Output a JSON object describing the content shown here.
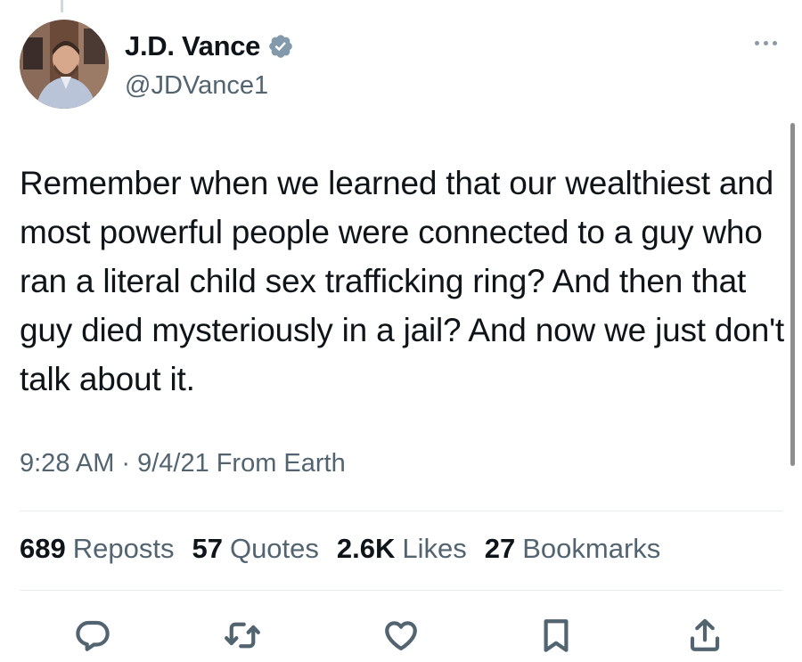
{
  "tweet": {
    "author": {
      "name": "J.D. Vance",
      "handle": "@JDVance1",
      "verified": true
    },
    "text": "Remember when we learned that our wealthiest and most powerful people were connected to a guy who ran a literal child sex trafficking ring? And then that guy died mysteriously in a jail? And now we just don't talk about it.",
    "time": "9:28 AM",
    "separator": "·",
    "date": "9/4/21",
    "source": "From Earth",
    "stats": [
      {
        "value": "689",
        "label": "Reposts"
      },
      {
        "value": "57",
        "label": "Quotes"
      },
      {
        "value": "2.6K",
        "label": "Likes"
      },
      {
        "value": "27",
        "label": "Bookmarks"
      }
    ],
    "actions": [
      {
        "name": "reply",
        "icon": "reply-icon"
      },
      {
        "name": "repost",
        "icon": "repost-icon"
      },
      {
        "name": "like",
        "icon": "heart-icon"
      },
      {
        "name": "bookmark",
        "icon": "bookmark-icon"
      },
      {
        "name": "share",
        "icon": "share-icon"
      }
    ]
  },
  "colors": {
    "text": "#0f1419",
    "secondary": "#536471",
    "verified": "#829aab",
    "divider": "#e6ecf0"
  }
}
